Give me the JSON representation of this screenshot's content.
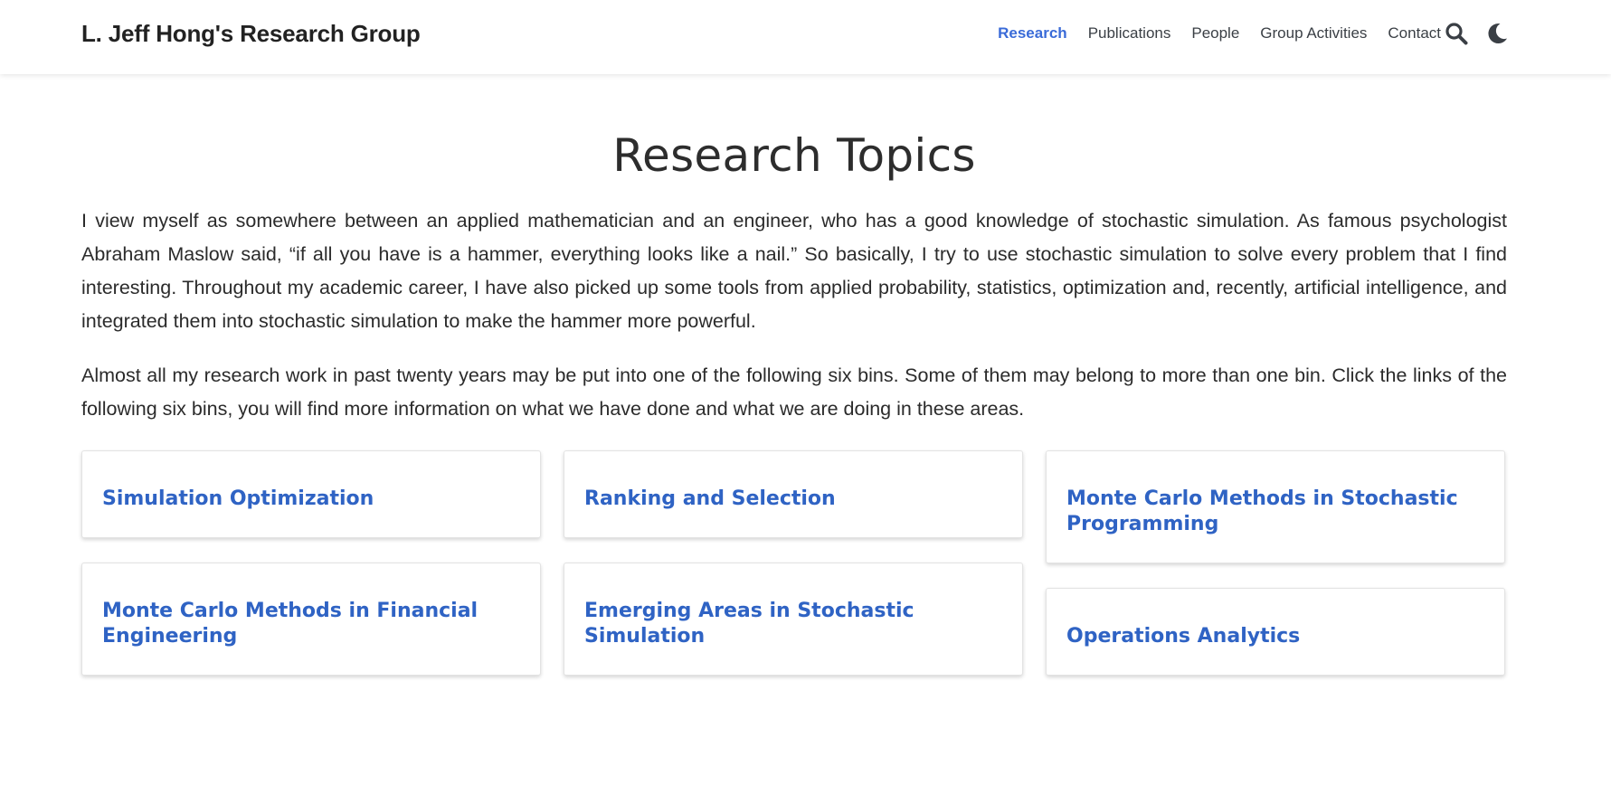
{
  "navbar": {
    "brand": "L. Jeff Hong's Research Group",
    "links": [
      {
        "label": "Research",
        "active": true
      },
      {
        "label": "Publications",
        "active": false
      },
      {
        "label": "People",
        "active": false
      },
      {
        "label": "Group Activities",
        "active": false
      },
      {
        "label": "Contact",
        "active": false
      }
    ],
    "icons": [
      "search-icon",
      "moon-icon"
    ]
  },
  "main": {
    "title": "Research Topics",
    "paragraphs": [
      "I view myself as somewhere between an applied mathematician and an engineer, who has a good knowledge of stochastic simulation. As famous psychologist Abraham Maslow said, “if all you have is a hammer, everything looks like a nail.” So basically, I try to use stochastic simulation to solve every problem that I find interesting. Throughout my academic career, I have also picked up some tools from applied probability, statistics, optimization and, recently, artificial intelligence, and integrated them into stochastic simulation to make the hammer more powerful.",
      "Almost all my research work in past twenty years may be put into one of the following six bins. Some of them may belong to more than one bin. Click the links of the following six bins, you will find more information on what we have done and what we are doing in these areas."
    ],
    "cards": [
      "Simulation Optimization",
      "Ranking and Selection",
      "Monte Carlo Methods in Stochastic Programming",
      "Monte Carlo Methods in Financial Engineering",
      "Emerging Areas in Stochastic Simulation",
      "Operations Analytics"
    ]
  },
  "colors": {
    "accent": "#3a6bd8",
    "card_title": "#2f63c4",
    "text": "#2b2b2b"
  }
}
